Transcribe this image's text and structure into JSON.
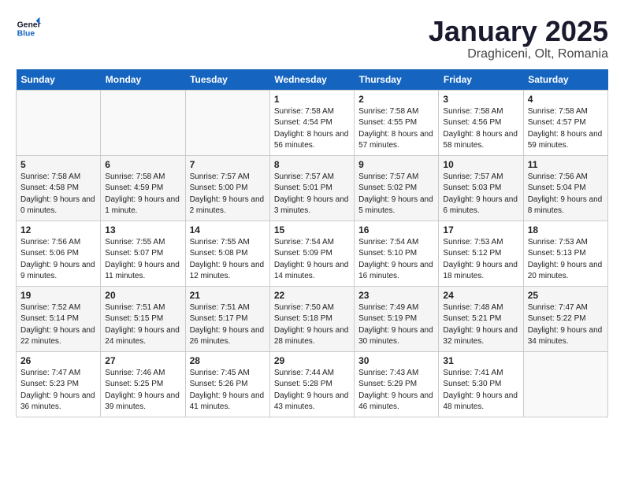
{
  "header": {
    "logo_line1": "General",
    "logo_line2": "Blue",
    "month_title": "January 2025",
    "location": "Draghiceni, Olt, Romania"
  },
  "days_of_week": [
    "Sunday",
    "Monday",
    "Tuesday",
    "Wednesday",
    "Thursday",
    "Friday",
    "Saturday"
  ],
  "weeks": [
    [
      {
        "day": "",
        "text": ""
      },
      {
        "day": "",
        "text": ""
      },
      {
        "day": "",
        "text": ""
      },
      {
        "day": "1",
        "text": "Sunrise: 7:58 AM\nSunset: 4:54 PM\nDaylight: 8 hours\nand 56 minutes."
      },
      {
        "day": "2",
        "text": "Sunrise: 7:58 AM\nSunset: 4:55 PM\nDaylight: 8 hours\nand 57 minutes."
      },
      {
        "day": "3",
        "text": "Sunrise: 7:58 AM\nSunset: 4:56 PM\nDaylight: 8 hours\nand 58 minutes."
      },
      {
        "day": "4",
        "text": "Sunrise: 7:58 AM\nSunset: 4:57 PM\nDaylight: 8 hours\nand 59 minutes."
      }
    ],
    [
      {
        "day": "5",
        "text": "Sunrise: 7:58 AM\nSunset: 4:58 PM\nDaylight: 9 hours\nand 0 minutes."
      },
      {
        "day": "6",
        "text": "Sunrise: 7:58 AM\nSunset: 4:59 PM\nDaylight: 9 hours\nand 1 minute."
      },
      {
        "day": "7",
        "text": "Sunrise: 7:57 AM\nSunset: 5:00 PM\nDaylight: 9 hours\nand 2 minutes."
      },
      {
        "day": "8",
        "text": "Sunrise: 7:57 AM\nSunset: 5:01 PM\nDaylight: 9 hours\nand 3 minutes."
      },
      {
        "day": "9",
        "text": "Sunrise: 7:57 AM\nSunset: 5:02 PM\nDaylight: 9 hours\nand 5 minutes."
      },
      {
        "day": "10",
        "text": "Sunrise: 7:57 AM\nSunset: 5:03 PM\nDaylight: 9 hours\nand 6 minutes."
      },
      {
        "day": "11",
        "text": "Sunrise: 7:56 AM\nSunset: 5:04 PM\nDaylight: 9 hours\nand 8 minutes."
      }
    ],
    [
      {
        "day": "12",
        "text": "Sunrise: 7:56 AM\nSunset: 5:06 PM\nDaylight: 9 hours\nand 9 minutes."
      },
      {
        "day": "13",
        "text": "Sunrise: 7:55 AM\nSunset: 5:07 PM\nDaylight: 9 hours\nand 11 minutes."
      },
      {
        "day": "14",
        "text": "Sunrise: 7:55 AM\nSunset: 5:08 PM\nDaylight: 9 hours\nand 12 minutes."
      },
      {
        "day": "15",
        "text": "Sunrise: 7:54 AM\nSunset: 5:09 PM\nDaylight: 9 hours\nand 14 minutes."
      },
      {
        "day": "16",
        "text": "Sunrise: 7:54 AM\nSunset: 5:10 PM\nDaylight: 9 hours\nand 16 minutes."
      },
      {
        "day": "17",
        "text": "Sunrise: 7:53 AM\nSunset: 5:12 PM\nDaylight: 9 hours\nand 18 minutes."
      },
      {
        "day": "18",
        "text": "Sunrise: 7:53 AM\nSunset: 5:13 PM\nDaylight: 9 hours\nand 20 minutes."
      }
    ],
    [
      {
        "day": "19",
        "text": "Sunrise: 7:52 AM\nSunset: 5:14 PM\nDaylight: 9 hours\nand 22 minutes."
      },
      {
        "day": "20",
        "text": "Sunrise: 7:51 AM\nSunset: 5:15 PM\nDaylight: 9 hours\nand 24 minutes."
      },
      {
        "day": "21",
        "text": "Sunrise: 7:51 AM\nSunset: 5:17 PM\nDaylight: 9 hours\nand 26 minutes."
      },
      {
        "day": "22",
        "text": "Sunrise: 7:50 AM\nSunset: 5:18 PM\nDaylight: 9 hours\nand 28 minutes."
      },
      {
        "day": "23",
        "text": "Sunrise: 7:49 AM\nSunset: 5:19 PM\nDaylight: 9 hours\nand 30 minutes."
      },
      {
        "day": "24",
        "text": "Sunrise: 7:48 AM\nSunset: 5:21 PM\nDaylight: 9 hours\nand 32 minutes."
      },
      {
        "day": "25",
        "text": "Sunrise: 7:47 AM\nSunset: 5:22 PM\nDaylight: 9 hours\nand 34 minutes."
      }
    ],
    [
      {
        "day": "26",
        "text": "Sunrise: 7:47 AM\nSunset: 5:23 PM\nDaylight: 9 hours\nand 36 minutes."
      },
      {
        "day": "27",
        "text": "Sunrise: 7:46 AM\nSunset: 5:25 PM\nDaylight: 9 hours\nand 39 minutes."
      },
      {
        "day": "28",
        "text": "Sunrise: 7:45 AM\nSunset: 5:26 PM\nDaylight: 9 hours\nand 41 minutes."
      },
      {
        "day": "29",
        "text": "Sunrise: 7:44 AM\nSunset: 5:28 PM\nDaylight: 9 hours\nand 43 minutes."
      },
      {
        "day": "30",
        "text": "Sunrise: 7:43 AM\nSunset: 5:29 PM\nDaylight: 9 hours\nand 46 minutes."
      },
      {
        "day": "31",
        "text": "Sunrise: 7:41 AM\nSunset: 5:30 PM\nDaylight: 9 hours\nand 48 minutes."
      },
      {
        "day": "",
        "text": ""
      }
    ]
  ]
}
